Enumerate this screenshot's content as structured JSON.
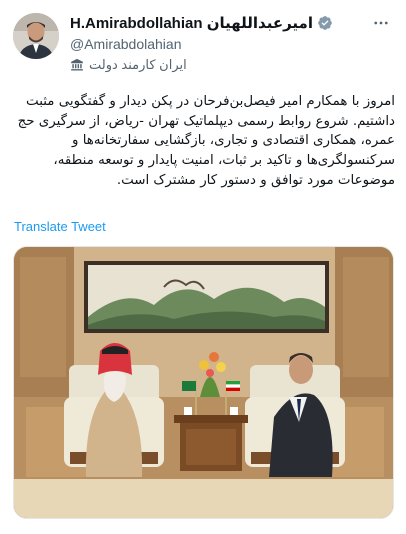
{
  "author": {
    "name": "H.Amirabdollahian امیرعبداللهیان",
    "handle": "@Amirabdolahian",
    "label": "ایران کارمند دولت"
  },
  "tweet": {
    "text": "امروز با همکارم امیر فیصل‌بن‌فرحان در پکن دیدار و گفتگویی مثبت داشتیم. شروع روابط رسمی دیپلماتیک تهران -ریاض، از سرگیری حج عمره، همکاری اقتصادی و تجاری، بازگشایی سفارتخانه‌ها و سرکنسولگری‌ها و تاکید بر ثبات، امنیت پایدار و توسعه منطقه، موضوعات مورد توافق و دستور کار مشترک است.",
    "translate_label": "Translate Tweet"
  },
  "icons": {
    "verified": "verified-badge-icon",
    "government": "government-building-icon",
    "more": "more-options-icon"
  },
  "colors": {
    "link": "#1d9bf0",
    "secondary_text": "#536471",
    "verified": "#829aab"
  }
}
